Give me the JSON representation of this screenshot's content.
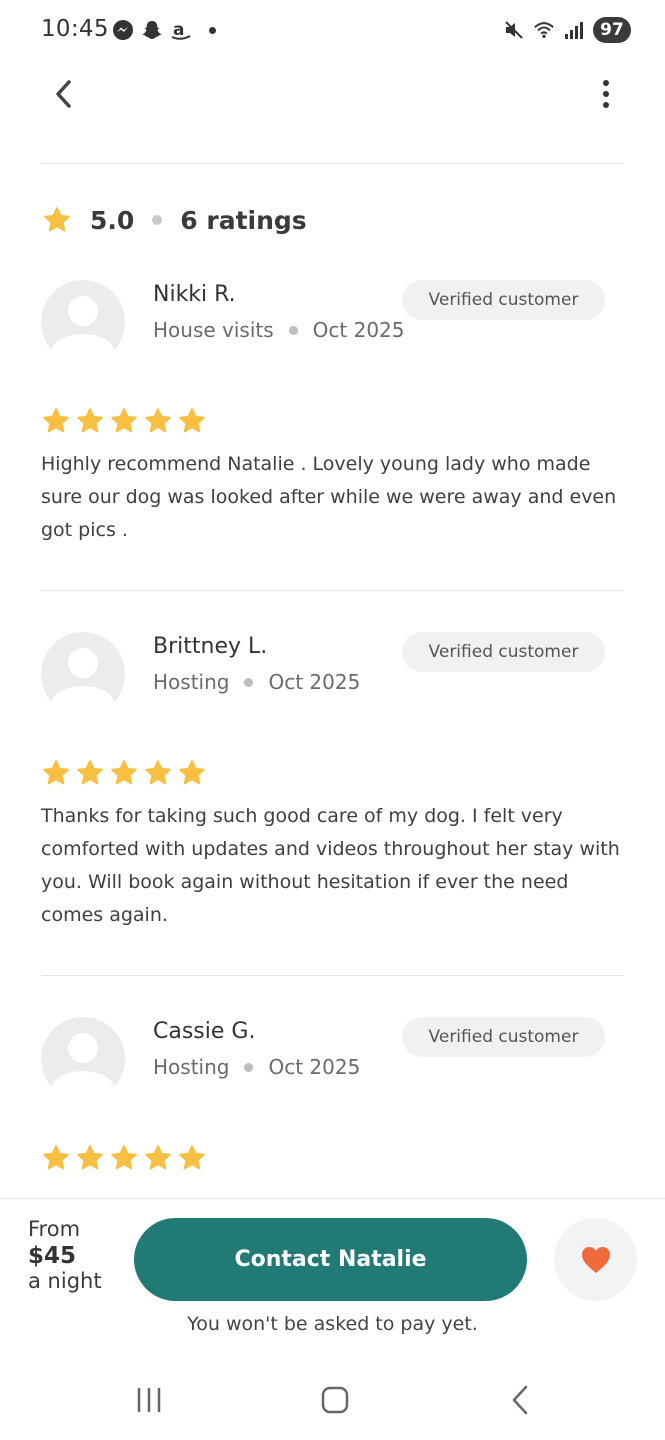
{
  "status_bar": {
    "time": "10:45",
    "left_icons": [
      "messenger-icon",
      "snapchat-icon",
      "amazon-icon",
      "notification-dot"
    ],
    "right_icons": [
      "mute-icon",
      "wifi-icon",
      "signal-icon"
    ],
    "battery": "97"
  },
  "app_bar": {
    "back_icon": "chevron-left-icon",
    "menu_icon": "more-vertical-icon"
  },
  "summary": {
    "score": "5.0",
    "count": "6 ratings"
  },
  "reviews": [
    {
      "name": "Nikki R.",
      "service": "House visits",
      "date": "Oct 2025",
      "badge": "Verified customer",
      "rating": 5,
      "text": "Highly recommend Natalie . Lovely young lady who made sure our dog was looked after while we were away and even got pics ."
    },
    {
      "name": "Brittney L.",
      "service": "Hosting",
      "date": "Oct 2025",
      "badge": "Verified customer",
      "rating": 5,
      "text": "Thanks for taking such good care of my dog. I felt very comforted with updates and videos throughout her stay with you. Will book again without hesitation if ever the need comes again."
    },
    {
      "name": "Cassie G.",
      "service": "Hosting",
      "date": "Oct 2025",
      "badge": "Verified customer",
      "rating": 5,
      "text": ""
    }
  ],
  "footer": {
    "from_label": "From",
    "price": "$45",
    "unit": "a night",
    "contact_label": "Contact Natalie",
    "pay_note": "You won't be asked to pay yet.",
    "favorite_icon": "heart-icon"
  },
  "colors": {
    "primary": "#217a76",
    "star": "#f7c042",
    "heart": "#f26a3c"
  }
}
